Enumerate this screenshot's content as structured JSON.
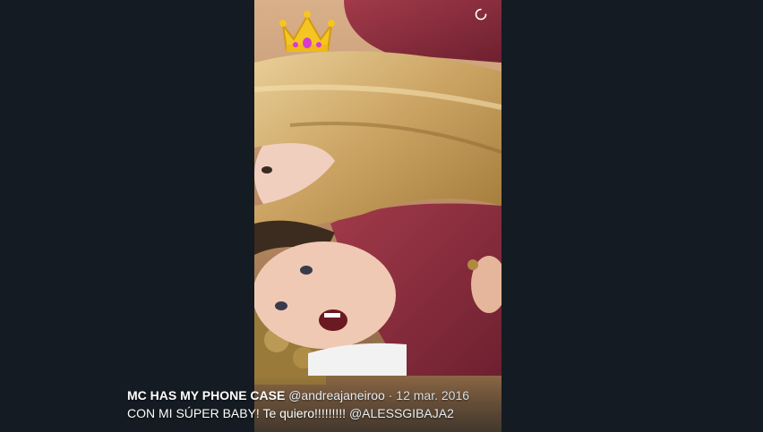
{
  "tweet": {
    "author_name": "MC HAS MY PHONE CASE",
    "handle": "@andreajaneiroo",
    "separator": "·",
    "date": "12 mar. 2016",
    "text": "CON MI SÚPER BABY! Te quiero!!!!!!!!!",
    "mention": "@ALESSGIBAJA2"
  },
  "media": {
    "overlay_emoji": "crown-emoji",
    "loading_indicator": "loading-spinner-icon"
  },
  "colors": {
    "background": "#141b22",
    "sweater": "#8e2f3e",
    "hair": "#d8b777"
  }
}
